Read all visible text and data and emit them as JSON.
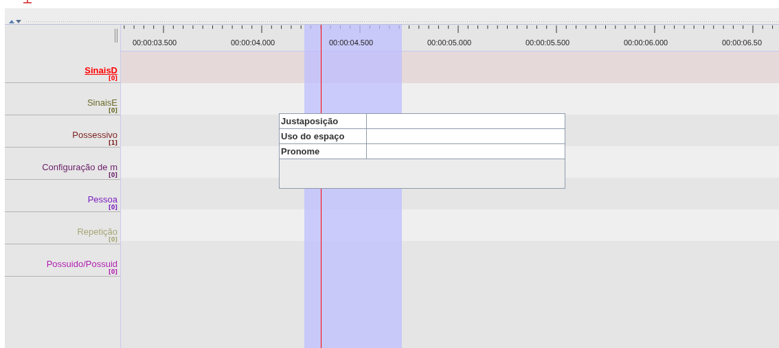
{
  "ruler": {
    "labels": [
      "00:00:03.500",
      "00:00:04.000",
      "00:00:04.500",
      "00:00:05.000",
      "00:00:05.500",
      "00:00:06.000",
      "00:00:06.50"
    ]
  },
  "tiers": [
    {
      "name": "SinaisD",
      "count": "[0]",
      "color": "#ff0000",
      "selected": true
    },
    {
      "name": "SinaisE",
      "count": "[0]",
      "color": "#6b6b2a",
      "selected": false
    },
    {
      "name": "Possessivo",
      "count": "[1]",
      "color": "#7a1e1e",
      "selected": false
    },
    {
      "name": "Configuração de m",
      "count": "[0]",
      "color": "#6a1f6a",
      "selected": false
    },
    {
      "name": "Pessoa",
      "count": "[0]",
      "color": "#7a1fbf",
      "selected": false
    },
    {
      "name": "Repetição",
      "count": "[0]",
      "color": "#a6a677",
      "selected": false
    },
    {
      "name": "Possuido/Possuid",
      "count": "[0]",
      "color": "#b01fb0",
      "selected": false
    }
  ],
  "popup": {
    "rows": [
      "Justaposição",
      "Uso do espaço",
      "Pronome"
    ]
  }
}
